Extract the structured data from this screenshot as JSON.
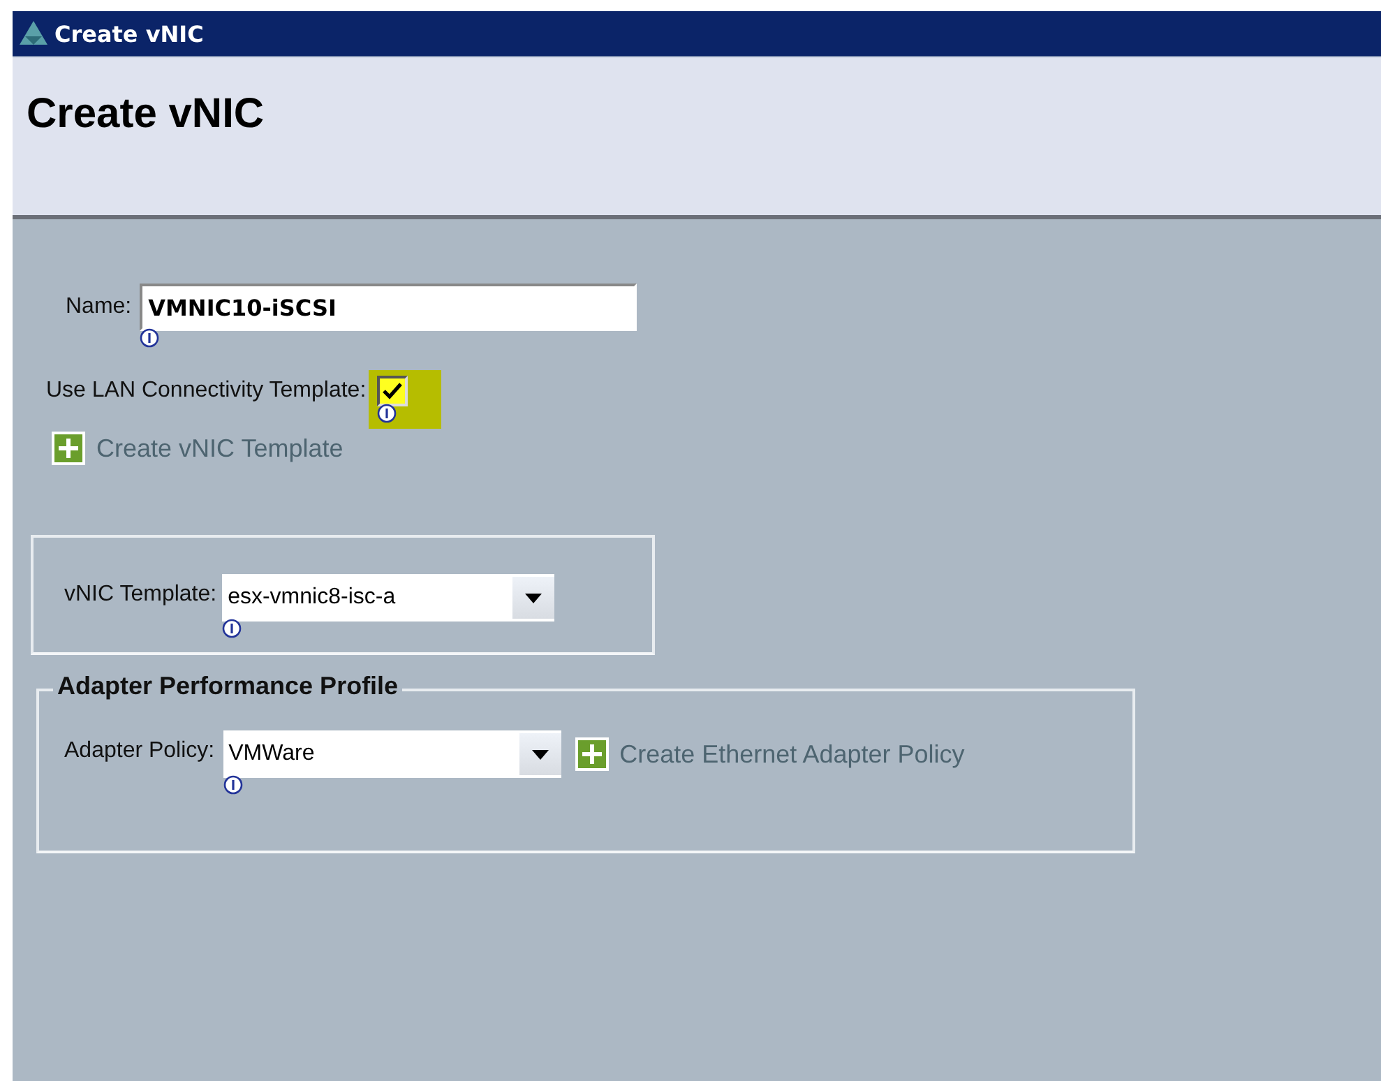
{
  "window": {
    "title": "Create vNIC"
  },
  "header": {
    "title": "Create vNIC"
  },
  "name_field": {
    "label": "Name:",
    "value": "VMNIC10-iSCSI"
  },
  "lan_template": {
    "label": "Use LAN Connectivity Template:",
    "checked": true
  },
  "create_template_link": {
    "label": "Create vNIC Template"
  },
  "vnic_template": {
    "label": "vNIC Template:",
    "value": "esx-vmnic8-isc-a"
  },
  "adapter_profile": {
    "title": "Adapter Performance Profile",
    "label": "Adapter Policy:",
    "value": "VMWare",
    "link": "Create Ethernet Adapter Policy"
  }
}
